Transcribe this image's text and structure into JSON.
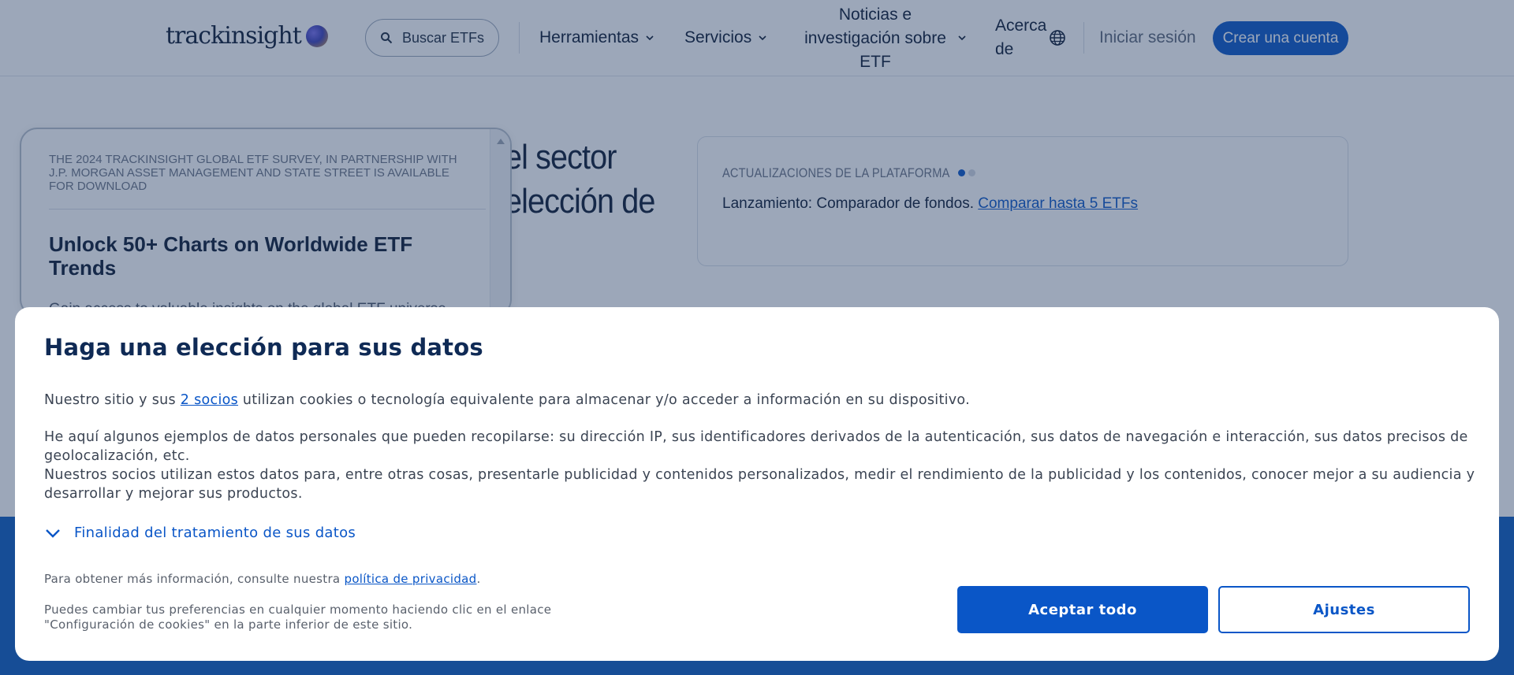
{
  "navbar": {
    "logo_text": "trackinsight",
    "search_label": "Buscar ETFs",
    "tools_label": "Herramientas",
    "services_label": "Servicios",
    "news_line1": "Noticias e",
    "news_line2": "investigación sobre",
    "news_line3": "ETF",
    "about_line1": "Acerca",
    "about_line2": "de",
    "login_label": "Iniciar sesión",
    "signup_label": "Crear una cuenta",
    "icons": [
      "search-icon",
      "chevron-down-icon",
      "globe-icon"
    ]
  },
  "hero": {
    "line1": "el sector",
    "line2": "elección de"
  },
  "updates": {
    "label": "ACTUALIZACIONES DE LA PLATAFORMA",
    "text": "Lanzamiento: Comparador de fondos.",
    "link": "Comparar hasta 5 ETFs"
  },
  "promo": {
    "eyebrow": "THE 2024 TRACKINSIGHT GLOBAL ETF SURVEY, IN PARTNERSHIP WITH J.P. MORGAN ASSET MANAGEMENT AND STATE STREET IS AVAILABLE FOR DOWNLOAD",
    "title": "Unlock 50+ Charts on Worldwide ETF Trends",
    "desc": "Gain access to valuable insights on the global ETF universe"
  },
  "consent": {
    "title": "Haga una elección para sus datos",
    "p1_before": "Nuestro sitio y sus ",
    "p1_link": "2 socios",
    "p1_after": " utilizan cookies o tecnología equivalente para almacenar y/o acceder a información en su dispositivo.",
    "p2": "He aquí algunos ejemplos de datos personales que pueden recopilarse: su dirección IP, sus identificadores derivados de la autenticación, sus datos de navegación e interacción, sus datos precisos de geolocalización, etc.",
    "p3": "Nuestros socios utilizan estos datos para, entre otras cosas, presentarle publicidad y contenidos personalizados, medir el rendimiento de la publicidad y los contenidos, conocer mejor a su audiencia y desarrollar y mejorar sus productos.",
    "expander_label": "Finalidad del tratamiento de sus datos",
    "info_before": "Para obtener más información, consulte nuestra ",
    "info_link": "política de privacidad",
    "info_after": ".",
    "change_line1": "Puedes cambiar tus preferencias en cualquier momento haciendo clic en el enlace",
    "change_line2": "\"Configuración de cookies\" en la parte inferior de este sitio.",
    "accept_label": "Aceptar todo",
    "settings_label": "Ajustes"
  },
  "colors": {
    "accent": "#0a56c7",
    "title": "#0f2a55",
    "band": "#0b5bbf"
  }
}
